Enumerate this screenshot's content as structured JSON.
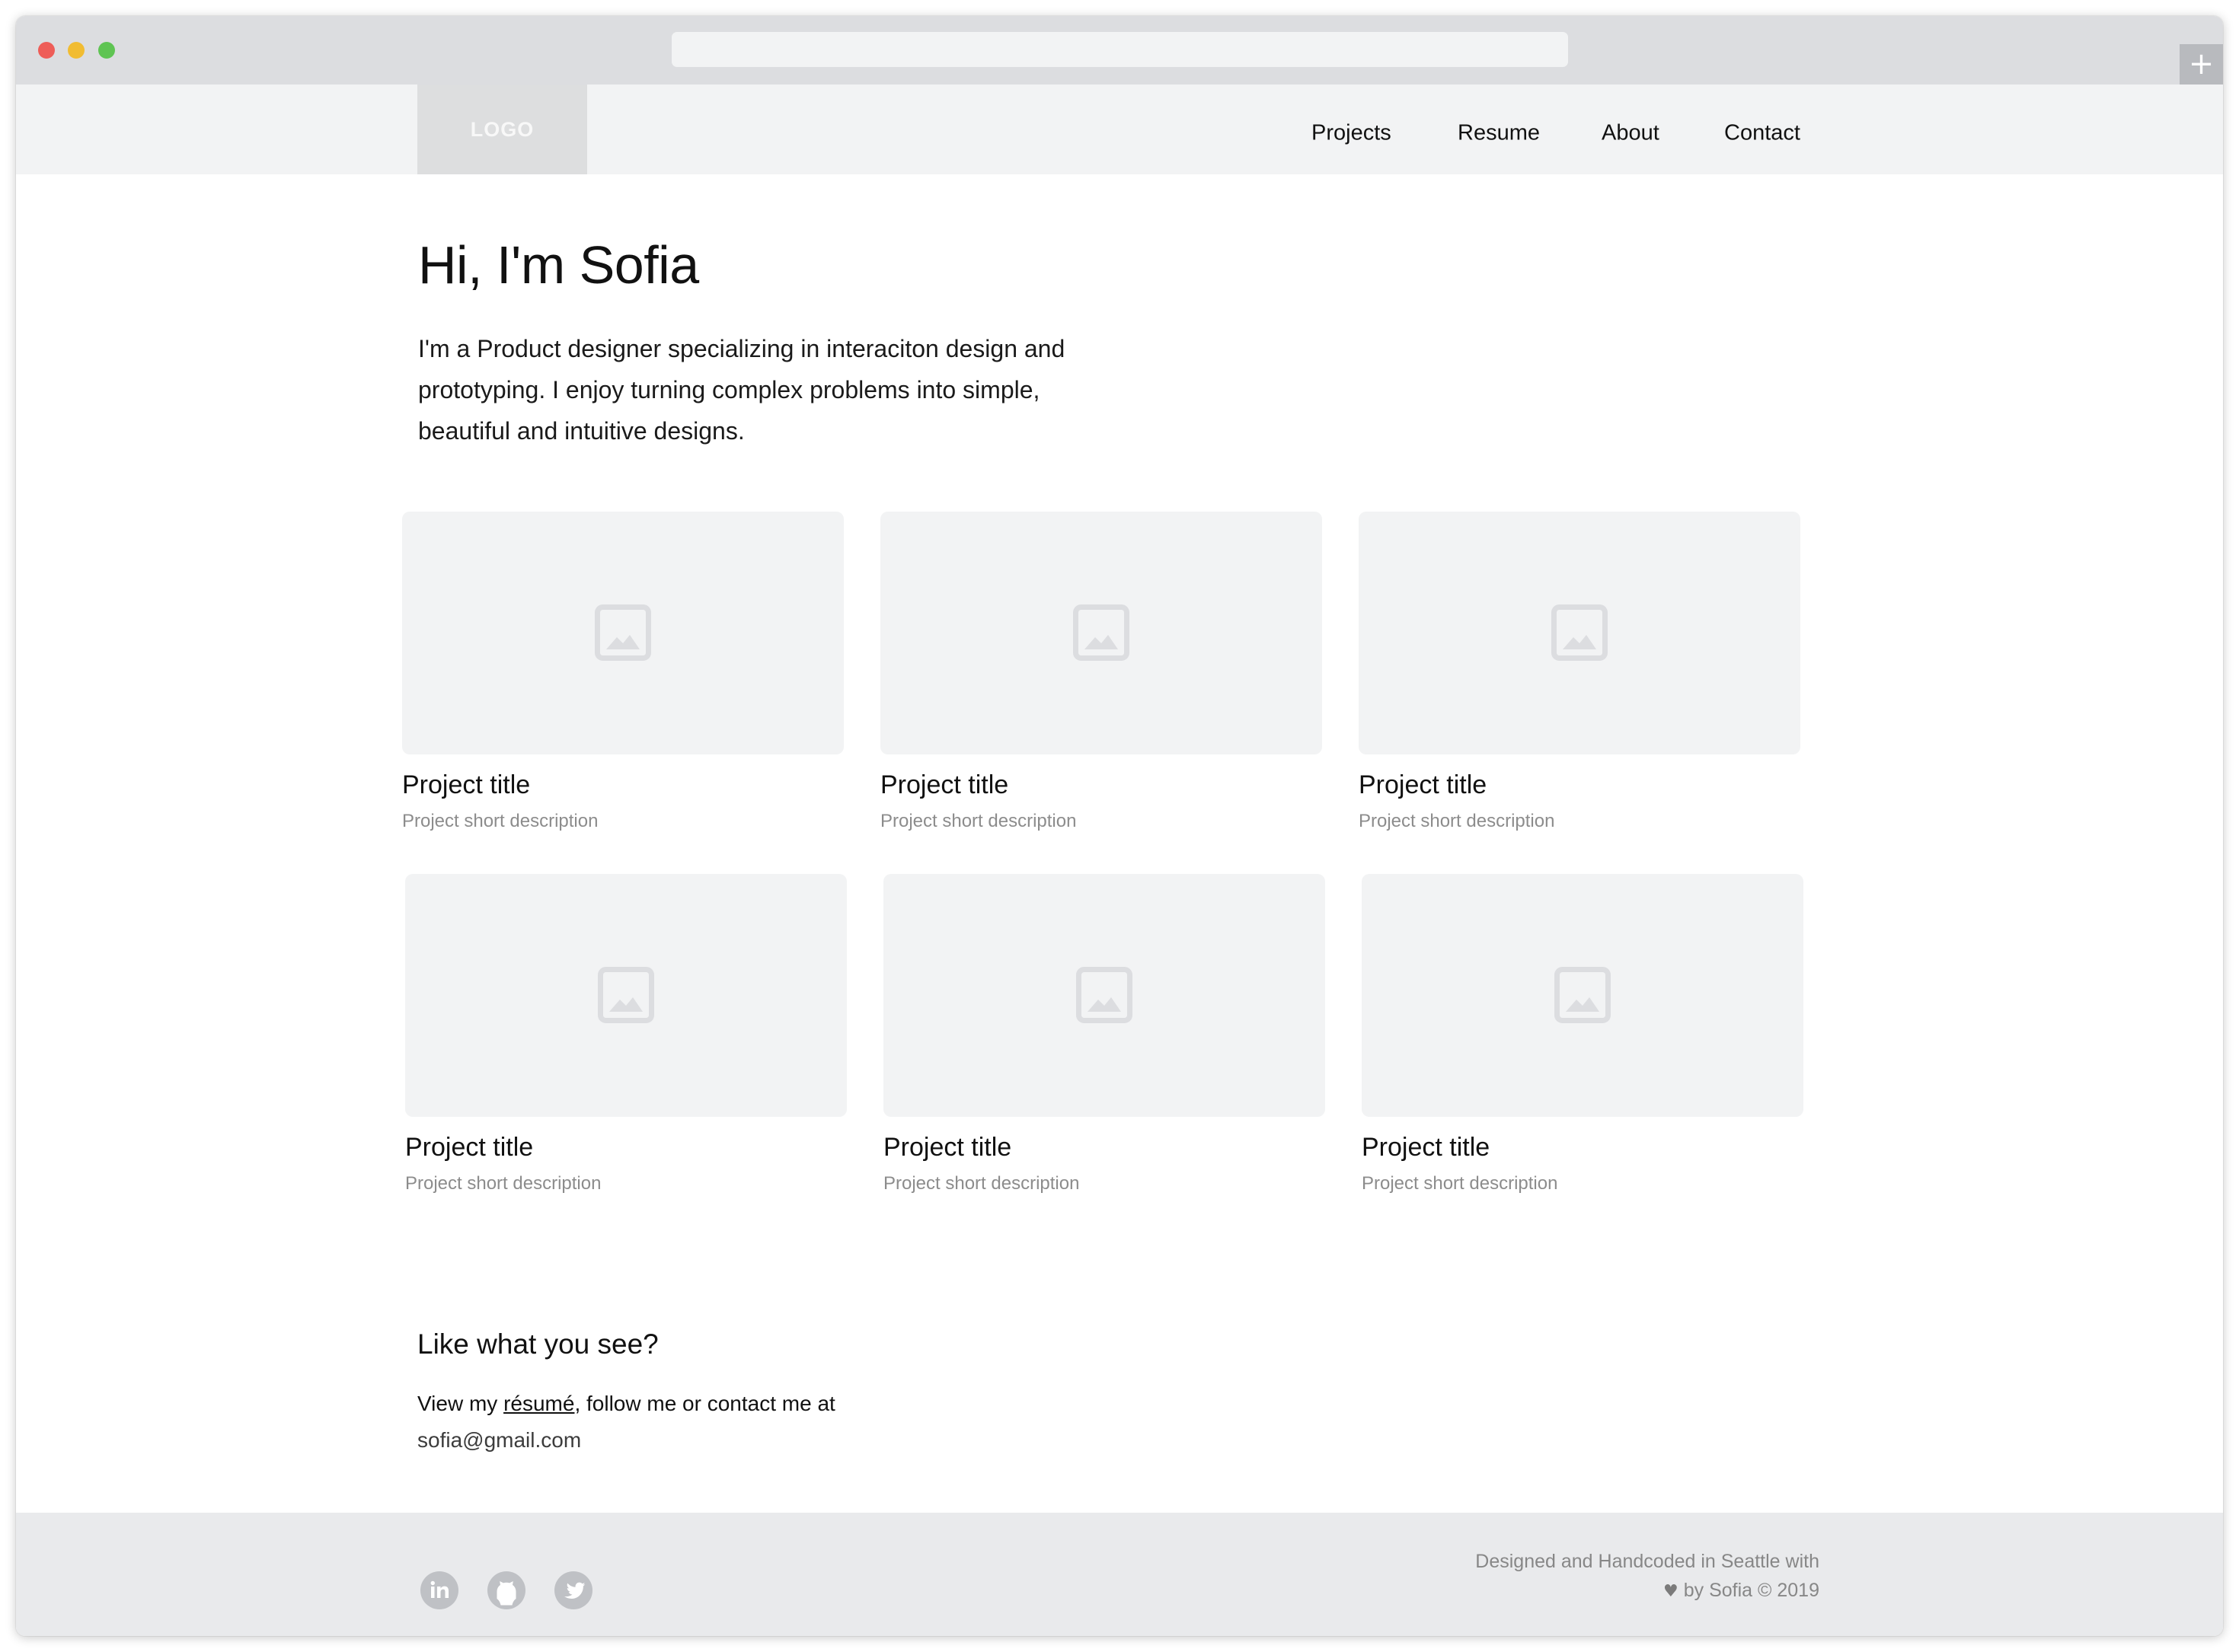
{
  "browser": {
    "colors": {
      "close": "#ee5d58",
      "minimize": "#f1bc32",
      "zoom": "#5fc453"
    },
    "new_tab_label": "+"
  },
  "nav": {
    "logo": "LOGO",
    "links": [
      "Projects",
      "Resume",
      "About",
      "Contact"
    ]
  },
  "hero": {
    "title": "Hi, I'm Sofia",
    "lines": [
      "I'm a Product designer specializing in interaciton design and",
      "prototyping. I enjoy turning complex problems into simple,",
      "beautiful and intuitive designs."
    ]
  },
  "projects": [
    {
      "title": "Project title",
      "description": "Project short description",
      "icon": "image-placeholder-icon"
    },
    {
      "title": "Project title",
      "description": "Project short description",
      "icon": "image-placeholder-icon"
    },
    {
      "title": "Project title",
      "description": "Project short description",
      "icon": "image-placeholder-icon"
    },
    {
      "title": "Project title",
      "description": "Project short description",
      "icon": "image-placeholder-icon"
    },
    {
      "title": "Project title",
      "description": "Project short description",
      "icon": "image-placeholder-icon"
    },
    {
      "title": "Project title",
      "description": "Project short description",
      "icon": "image-placeholder-icon"
    }
  ],
  "cta": {
    "title": "Like what you see?",
    "text_before": "View my ",
    "resume_link": "résumé",
    "text_after": ", follow me or contact me at",
    "email": "sofia@gmail.com"
  },
  "footer": {
    "social": [
      "linkedin-icon",
      "github-icon",
      "twitter-icon"
    ],
    "line1": "Designed and Handcoded in Seattle with",
    "heart": "♥",
    "line2": " by Sofia © 2019"
  }
}
